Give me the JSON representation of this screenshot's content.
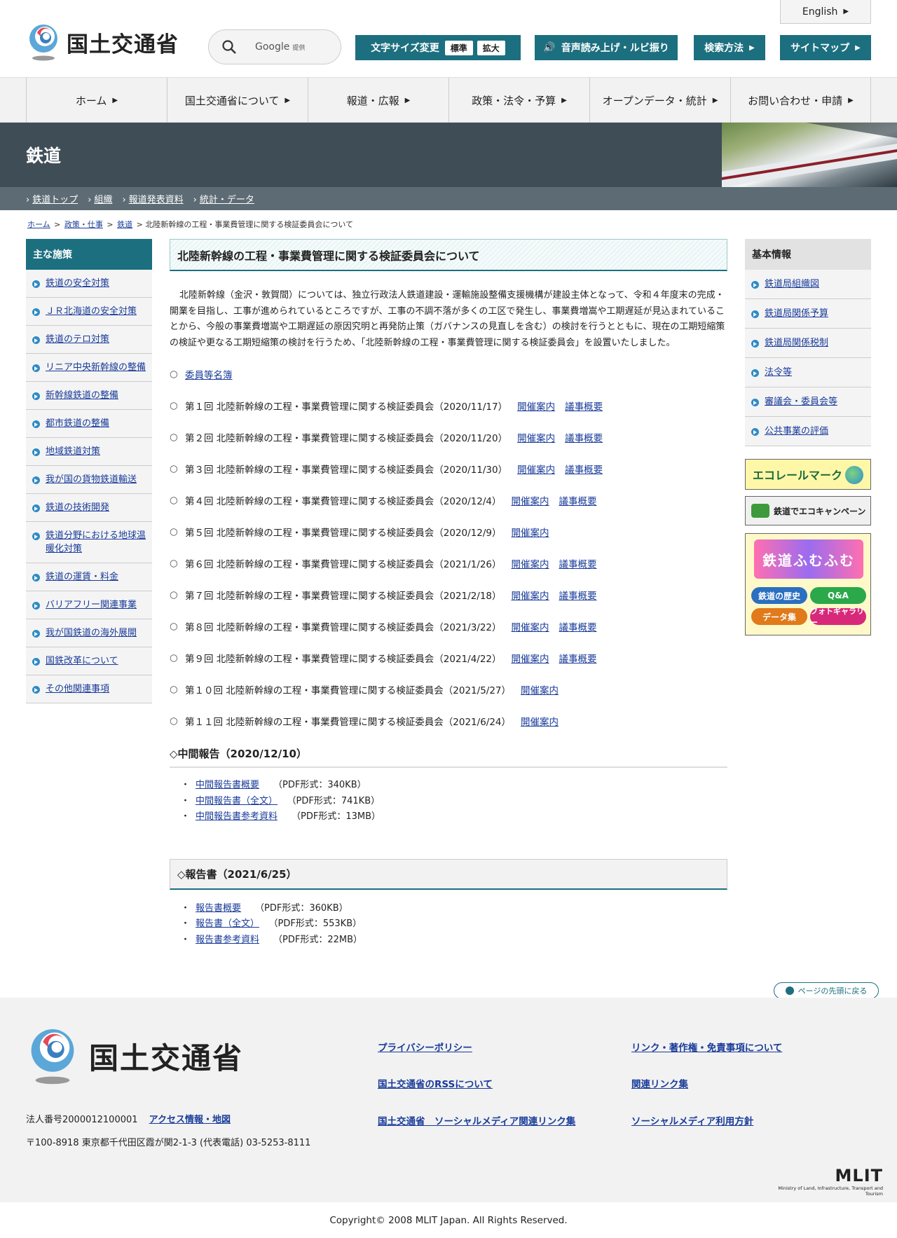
{
  "header": {
    "logo_text": "国土交通省",
    "search_text": "Google",
    "search_sub": "提供",
    "lang": "English",
    "font_size_label": "文字サイズ変更",
    "font_std": "標準",
    "font_large": "拡大",
    "voice_label": "音声読み上げ・ルビ振り",
    "search_method": "検索方法",
    "sitemap": "サイトマップ"
  },
  "gnav": [
    "ホーム",
    "国土交通省について",
    "報道・広報",
    "政策・法令・予算",
    "オープンデータ・統計",
    "お問い合わせ・申請"
  ],
  "banner": {
    "title": "鉄道",
    "subnav": [
      "鉄道トップ",
      "組織",
      "報道発表資料",
      "統計・データ"
    ]
  },
  "breadcrumb": {
    "items": [
      "ホーム",
      "政策・仕事",
      "鉄道"
    ],
    "current": "北陸新幹線の工程・事業費管理に関する検証委員会について"
  },
  "left_sidebar": {
    "heading": "主な施策",
    "items": [
      "鉄道の安全対策",
      "ＪＲ北海道の安全対策",
      "鉄道のテロ対策",
      "リニア中央新幹線の整備",
      "新幹線鉄道の整備",
      "都市鉄道の整備",
      "地域鉄道対策",
      "我が国の貨物鉄道輸送",
      "鉄道の技術開発",
      "鉄道分野における地球温暖化対策",
      "鉄道の運賃・料金",
      "バリアフリー関連事業",
      "我が国鉄道の海外展開",
      "国鉄改革について",
      "その他関連事項"
    ]
  },
  "main": {
    "title": "北陸新幹線の工程・事業費管理に関する検証委員会について",
    "intro": "北陸新幹線（金沢・敦賀間）については、独立行政法人鉄道建設・運輸施設整備支援機構が建設主体となって、令和４年度末の完成・開業を目指し、工事が進められているところですが、工事の不調不落が多くの工区で発生し、事業費増嵩や工期遅延が見込まれていることから、今般の事業費増嵩や工期遅延の原因究明と再発防止策（ガバナンスの見直しを含む）の検討を行うとともに、現在の工期短縮策の検証や更なる工期短縮策の検討を行うため、「北陸新幹線の工程・事業費管理に関する検証委員会」を設置いたしました。",
    "members_link": "委員等名簿",
    "meetings": [
      {
        "label": "第１回 北陸新幹線の工程・事業費管理に関する検証委員会（2020/11/17）",
        "notice": "開催案内",
        "summary": "議事概要"
      },
      {
        "label": "第２回 北陸新幹線の工程・事業費管理に関する検証委員会（2020/11/20）",
        "notice": "開催案内",
        "summary": "議事概要"
      },
      {
        "label": "第３回 北陸新幹線の工程・事業費管理に関する検証委員会（2020/11/30）",
        "notice": "開催案内",
        "summary": "議事概要"
      },
      {
        "label": "第４回 北陸新幹線の工程・事業費管理に関する検証委員会（2020/12/4）",
        "notice": "開催案内",
        "summary": "議事概要"
      },
      {
        "label": "第５回 北陸新幹線の工程・事業費管理に関する検証委員会（2020/12/9）",
        "notice": "開催案内",
        "summary": ""
      },
      {
        "label": "第６回 北陸新幹線の工程・事業費管理に関する検証委員会（2021/1/26）",
        "notice": "開催案内",
        "summary": "議事概要"
      },
      {
        "label": "第７回 北陸新幹線の工程・事業費管理に関する検証委員会（2021/2/18）",
        "notice": "開催案内",
        "summary": "議事概要"
      },
      {
        "label": "第８回 北陸新幹線の工程・事業費管理に関する検証委員会（2021/3/22）",
        "notice": "開催案内",
        "summary": "議事概要"
      },
      {
        "label": "第９回 北陸新幹線の工程・事業費管理に関する検証委員会（2021/4/22）",
        "notice": "開催案内",
        "summary": "議事概要"
      },
      {
        "label": "第１０回 北陸新幹線の工程・事業費管理に関する検証委員会（2021/5/27）",
        "notice": "開催案内",
        "summary": ""
      },
      {
        "label": "第１１回 北陸新幹線の工程・事業費管理に関する検証委員会（2021/6/24）",
        "notice": "開催案内",
        "summary": ""
      }
    ],
    "interim": {
      "heading": "◇中間報告（2020/12/10）",
      "docs": [
        {
          "name": "中間報告書概要",
          "meta": "（PDF形式：340KB）"
        },
        {
          "name": "中間報告書（全文）",
          "meta": "（PDF形式：741KB）"
        },
        {
          "name": "中間報告書参考資料",
          "meta": "（PDF形式：13MB）"
        }
      ]
    },
    "report": {
      "heading": "◇報告書（2021/6/25）",
      "docs": [
        {
          "name": "報告書概要",
          "meta": "（PDF形式：360KB）"
        },
        {
          "name": "報告書（全文）",
          "meta": "（PDF形式：553KB）"
        },
        {
          "name": "報告書参考資料",
          "meta": "（PDF形式：22MB）"
        }
      ]
    }
  },
  "right_sidebar": {
    "heading": "基本情報",
    "items": [
      "鉄道局組織図",
      "鉄道局関係予算",
      "鉄道局関係税制",
      "法令等",
      "審議会・委員会等",
      "公共事業の評価"
    ],
    "eco_rail": "エコレールマーク",
    "eco_campaign": "鉄道でエコキャンペーン",
    "kids_title": "鉄道ふむふむ",
    "kids_buttons": [
      "鉄道の歴史",
      "Q&A",
      "データ集",
      "フォトギャラリー"
    ]
  },
  "to_top": "ページの先頭に戻る",
  "footer": {
    "logo_text": "国土交通省",
    "corp_number": "法人番号2000012100001",
    "access": "アクセス情報・地図",
    "address": "〒100-8918 東京都千代田区霞が関2-1-3 (代表電話) 03-5253-8111",
    "links": [
      "プライバシーポリシー",
      "リンク・著作権・免責事項について",
      "国土交通省のRSSについて",
      "関連リンク集",
      "国土交通省　ソーシャルメディア関連リンク集",
      "ソーシャルメディア利用方針"
    ],
    "mlit": "MLIT",
    "mlit_sub": "Ministry of Land, Infrastructure, Transport and Tourism",
    "copyright": "Copyright© 2008 MLIT Japan. All Rights Reserved."
  },
  "colors": {
    "accent": "#1c6f7f",
    "banner": "#3f4d57",
    "link": "#1a3c9a"
  }
}
